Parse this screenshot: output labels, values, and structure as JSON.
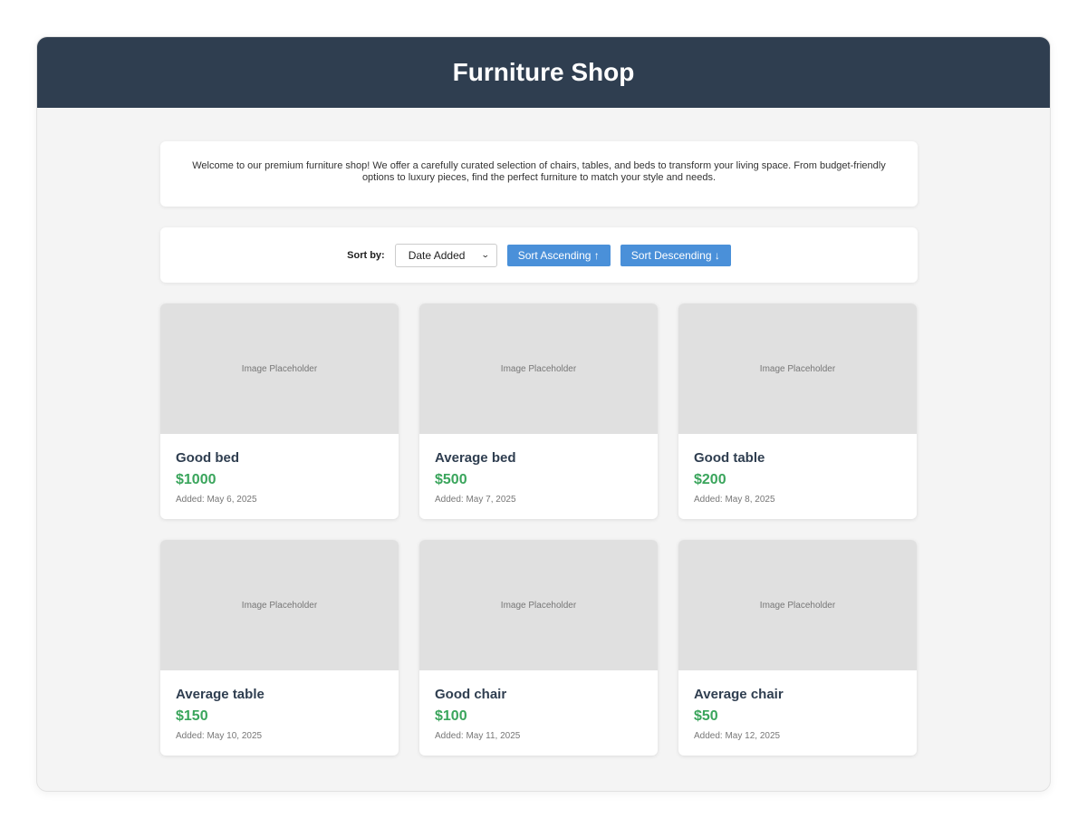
{
  "header": {
    "title": "Furniture Shop"
  },
  "intro": {
    "text": "Welcome to our premium furniture shop! We offer a carefully curated selection of chairs, tables, and beds to transform your living space. From budget-friendly options to luxury pieces, find the perfect furniture to match your style and needs."
  },
  "sort": {
    "label": "Sort by:",
    "selected": "Date Added",
    "ascending_label": "Sort Ascending ↑",
    "descending_label": "Sort Descending ↓"
  },
  "products": [
    {
      "name": "Good bed",
      "price": "$1000",
      "added": "Added: May 6, 2025",
      "image": "Image Placeholder"
    },
    {
      "name": "Average bed",
      "price": "$500",
      "added": "Added: May 7, 2025",
      "image": "Image Placeholder"
    },
    {
      "name": "Good table",
      "price": "$200",
      "added": "Added: May 8, 2025",
      "image": "Image Placeholder"
    },
    {
      "name": "Average table",
      "price": "$150",
      "added": "Added: May 10, 2025",
      "image": "Image Placeholder"
    },
    {
      "name": "Good chair",
      "price": "$100",
      "added": "Added: May 11, 2025",
      "image": "Image Placeholder"
    },
    {
      "name": "Average chair",
      "price": "$50",
      "added": "Added: May 12, 2025",
      "image": "Image Placeholder"
    }
  ],
  "icons": {
    "select": "chevron-down-icon"
  },
  "colors": {
    "header_bg": "#2f3e50",
    "button_bg": "#4a90d9",
    "price": "#3aa55c"
  }
}
